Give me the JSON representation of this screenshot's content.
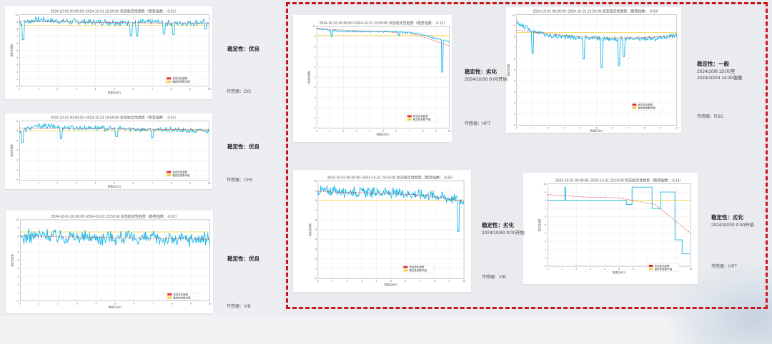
{
  "chart_data": [
    {
      "type": "line",
      "title": "2024-10-01 00:00:00~2024-10-31 23:59:00 状态稳定性趋势（趋势指数：-0.01）",
      "ylabel": "稳定性指数",
      "xlabel": "数据区间(T)",
      "ylim": [
        0,
        10
      ],
      "xlim": [
        0,
        10
      ],
      "x_ticks": [
        "0",
        "1",
        "2",
        "3",
        "4",
        "5",
        "6",
        "7",
        "8",
        "9",
        "10"
      ],
      "y_ticks": [
        "0",
        "1",
        "2",
        "3",
        "4",
        "5",
        "6",
        "7",
        "8",
        "9",
        "10"
      ],
      "legend": [
        "状态变化趋势",
        "稳定性参数市值"
      ],
      "threshold": 8.5,
      "trend": [
        9.1,
        9.0,
        8.9,
        8.85,
        8.85
      ],
      "profile": [
        8.9,
        9.3,
        9.1,
        9.0,
        9.0,
        9.0,
        8.8,
        9.0,
        8.8,
        8.9,
        9.0
      ],
      "noise": 0.5,
      "dips": [
        [
          0.2,
          6.5
        ],
        [
          5.9,
          7.0
        ],
        [
          6.2,
          7.0
        ],
        [
          7.6,
          7.3
        ],
        [
          8.1,
          7.2
        ],
        [
          9.8,
          8.0
        ]
      ],
      "stability": "稳定性：优良",
      "sensor": "传感器：DIS"
    },
    {
      "type": "line",
      "title": "2024-10-01 00:00:00~2024-10-31 23:59:00 状态稳定性趋势（趋势指数：-0.01）",
      "ylabel": "稳定性指数",
      "xlabel": "数据区间(T)",
      "ylim": [
        0,
        6
      ],
      "xlim": [
        0,
        10
      ],
      "x_ticks": [
        "0",
        "1",
        "2",
        "3",
        "4",
        "5",
        "6",
        "7",
        "8",
        "9",
        "10"
      ],
      "y_ticks": [
        "0",
        "1",
        "2",
        "3",
        "4",
        "5",
        "6"
      ],
      "legend": [
        "状态变化趋势",
        "稳定性参数市值"
      ],
      "threshold": 5.0,
      "trend": [
        5.3,
        5.25,
        5.2,
        5.15,
        5.1
      ],
      "profile": [
        5.0,
        5.5,
        5.4,
        5.3,
        5.3,
        5.2,
        5.2,
        5.1,
        5.1,
        5.0,
        5.0
      ],
      "noise": 0.3,
      "dips": [
        [
          0.15,
          3.8
        ],
        [
          2.2,
          4.2
        ],
        [
          5.1,
          4.4
        ],
        [
          7.0,
          4.3
        ]
      ],
      "stability": "稳定性：优良",
      "sensor": "传感器：CHS"
    },
    {
      "type": "line",
      "title": "2024-10-01 00:00:00~2024-10-31 23:59:00 状态稳定性趋势（趋势指数：-0.02）",
      "ylabel": "稳定性指数",
      "xlabel": "数据区间(T)",
      "ylim": [
        0,
        10
      ],
      "xlim": [
        0,
        10
      ],
      "x_ticks": [
        "0",
        "1",
        "2",
        "3",
        "4",
        "5",
        "6",
        "7",
        "8",
        "9",
        "10"
      ],
      "y_ticks": [
        "0",
        "1",
        "2",
        "3",
        "4",
        "5",
        "6",
        "7",
        "8",
        "9",
        "10"
      ],
      "legend": [
        "状态变化趋势",
        "稳定性参数市值"
      ],
      "threshold": 8.5,
      "trend": [
        8.0,
        7.9,
        7.8,
        7.7,
        7.6
      ],
      "profile": [
        7.8,
        8.1,
        8.0,
        7.9,
        7.8,
        7.8,
        7.7,
        7.7,
        7.6,
        7.6,
        7.6
      ],
      "noise": 1.0,
      "dips": [],
      "stability": "稳定性：优良",
      "sensor": "传感器：VIB"
    },
    {
      "type": "line",
      "title": "2024-10-01 00:00:00~2024-10-31 23:59:00 状态稳定性趋势（趋势指数：-0.12）",
      "ylabel": "稳定性指数",
      "xlabel": "数据区间(T)",
      "ylim": [
        0,
        10
      ],
      "xlim": [
        0,
        10
      ],
      "x_ticks": [
        "0",
        "1",
        "2",
        "3",
        "4",
        "5",
        "6",
        "7",
        "8",
        "9",
        "10"
      ],
      "y_ticks": [
        "0",
        "1",
        "2",
        "3",
        "4",
        "5",
        "6",
        "7",
        "8",
        "9",
        "10"
      ],
      "legend": [
        "状态变化趋势",
        "稳定性参数市值"
      ],
      "threshold": 9.1,
      "trend": [
        9.8,
        9.6,
        9.5,
        9.2,
        8.1
      ],
      "profile": [
        9.8,
        9.6,
        9.5,
        9.5,
        9.5,
        9.5,
        9.5,
        9.4,
        9.2,
        8.8,
        8.5
      ],
      "noise": 0.08,
      "dips": [
        [
          1.1,
          9.0
        ],
        [
          6.2,
          9.1
        ],
        [
          9.45,
          5.5
        ]
      ],
      "stability": "稳定性：劣化",
      "note": [
        "2024/10/30 9:00开始"
      ],
      "sensor": "传感器：HPT"
    },
    {
      "type": "line",
      "title": "2024-10-01 00:00:00~2024-10-31 23:59:00 状态稳定性趋势（趋势指数：-0.03）",
      "ylabel": "稳定性指数",
      "xlabel": "数据区间(T)",
      "ylim": [
        0,
        10
      ],
      "xlim": [
        0,
        10
      ],
      "x_ticks": [
        "0",
        "1",
        "2",
        "3",
        "4",
        "5",
        "6",
        "7",
        "8",
        "9",
        "10"
      ],
      "y_ticks": [
        "0",
        "1",
        "2",
        "3",
        "4",
        "5",
        "6",
        "7",
        "8",
        "9",
        "10"
      ],
      "legend": [
        "状态变化趋势",
        "稳定性参数市值"
      ],
      "threshold": 8.4,
      "trend": [
        8.6,
        8.2,
        7.9,
        7.9,
        8.1
      ],
      "profile": [
        9.2,
        8.6,
        8.1,
        8.0,
        7.9,
        7.9,
        7.8,
        7.8,
        7.8,
        7.9,
        8.2
      ],
      "noise": 0.25,
      "dips": [
        [
          1.0,
          6.5
        ],
        [
          4.2,
          6.0
        ],
        [
          5.3,
          5.2
        ],
        [
          6.4,
          5.4
        ],
        [
          6.7,
          6.2
        ]
      ],
      "stability": "稳定性：一般",
      "note": [
        "2024/10/8 15:00至",
        "2024/10/24 14:30偏差"
      ],
      "sensor": "传感器：RSG"
    },
    {
      "type": "line",
      "title": "2024-10-01 00:00:00~2024-10-31 23:59:00 状态稳定性趋势（趋势指数：-0.05）",
      "ylabel": "稳定性指数",
      "xlabel": "数据区间(T)",
      "ylim": [
        0,
        10
      ],
      "xlim": [
        0,
        10
      ],
      "x_ticks": [
        "0",
        "1",
        "2",
        "3",
        "4",
        "5",
        "6",
        "7",
        "8",
        "9",
        "10"
      ],
      "y_ticks": [
        "0",
        "1",
        "2",
        "3",
        "4",
        "5",
        "6",
        "7",
        "8",
        "9",
        "10"
      ],
      "legend": [
        "状态变化趋势",
        "稳定性参数市值"
      ],
      "threshold": 8.0,
      "trend": [
        8.9,
        8.8,
        8.7,
        8.5,
        7.9
      ],
      "profile": [
        9.0,
        9.0,
        8.9,
        8.8,
        8.8,
        8.7,
        8.7,
        8.6,
        8.5,
        8.2,
        8.0
      ],
      "noise": 0.6,
      "dips": [
        [
          9.6,
          4.8
        ]
      ],
      "stability": "稳定性：劣化",
      "note": [
        "2024/10/30 9:00开始"
      ],
      "sensor": "传感器：VIB"
    },
    {
      "type": "line",
      "title": "2024-10-01 00:00:00~2024-10-31 23:59:00 状态稳定性趋势（趋势指数：-0.14）",
      "ylabel": "稳定性指数",
      "xlabel": "数据区间(T)",
      "ylim": [
        0,
        10
      ],
      "xlim": [
        0,
        10
      ],
      "x_ticks": [
        "0",
        "1",
        "2",
        "3",
        "4",
        "5",
        "6",
        "7",
        "8",
        "9",
        "10"
      ],
      "y_ticks": [
        "0",
        "1",
        "2",
        "3",
        "4",
        "5",
        "6",
        "7",
        "8",
        "9",
        "10"
      ],
      "legend": [
        "状态变化趋势",
        "稳定性参数市值"
      ],
      "threshold": 8.0,
      "trend": [
        8.7,
        8.4,
        8.3,
        7.5,
        4.0
      ],
      "step": [
        [
          0,
          8.0
        ],
        [
          1.2,
          8.0
        ],
        [
          1.2,
          9.6
        ],
        [
          1.25,
          9.6
        ],
        [
          1.25,
          8.0
        ],
        [
          5.5,
          8.0
        ],
        [
          5.5,
          7.5
        ],
        [
          5.9,
          7.5
        ],
        [
          5.9,
          9.6
        ],
        [
          7.3,
          9.6
        ],
        [
          7.3,
          7.0
        ],
        [
          7.9,
          7.0
        ],
        [
          7.9,
          9.0
        ],
        [
          8.9,
          9.0
        ],
        [
          8.9,
          3.2
        ],
        [
          9.4,
          3.2
        ],
        [
          9.4,
          1.5
        ],
        [
          10,
          1.5
        ]
      ],
      "stability": "稳定性：劣化",
      "note": [
        "2024/10/30 9:00开始"
      ],
      "sensor": "传感器：HPT"
    }
  ],
  "colors": {
    "series": "#18b8e6",
    "trend": "#e03030",
    "threshold": "#f2d23c",
    "region_border": "#c8161d"
  }
}
